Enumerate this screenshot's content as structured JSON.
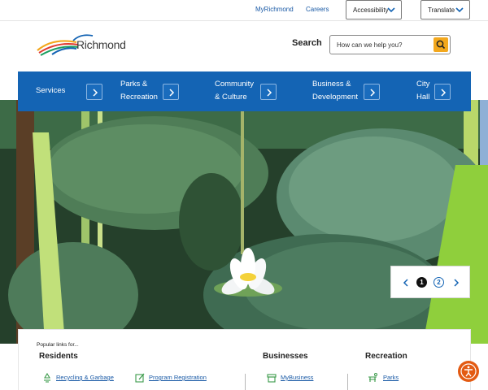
{
  "utility": {
    "links": [
      "MyRichmond",
      "Careers"
    ],
    "accessibility_label": "Accessibility",
    "translate_label": "Translate"
  },
  "header": {
    "logo_text": "Richmond",
    "search_label": "Search",
    "search_placeholder": "How can we help you?"
  },
  "nav": {
    "items": [
      {
        "line1": "Services",
        "line2": ""
      },
      {
        "line1": "Parks &",
        "line2": "Recreation"
      },
      {
        "line1": "Community",
        "line2": "& Culture"
      },
      {
        "line1": "Business &",
        "line2": "Development"
      },
      {
        "line1": "City",
        "line2": "Hall"
      }
    ]
  },
  "hero": {
    "slides": [
      "1",
      "2"
    ],
    "current_slide": 1
  },
  "popular": {
    "title": "Popular links for...",
    "columns": [
      {
        "heading": "Residents",
        "links": [
          "Recycling & Garbage",
          "Program Registration"
        ]
      },
      {
        "heading": "Businesses",
        "links": [
          "MyBusiness"
        ]
      },
      {
        "heading": "Recreation",
        "links": [
          "Parks"
        ]
      }
    ]
  },
  "colors": {
    "nav_blue": "#1464b4",
    "search_button": "#f3a81d",
    "accessibility_button": "#e35a12"
  },
  "icons": [
    "chevron-down-icon",
    "search-icon",
    "chevron-right-icon",
    "chevron-left-icon",
    "recycle-icon",
    "edit-icon",
    "shop-icon",
    "bench-icon",
    "accessibility-icon"
  ]
}
